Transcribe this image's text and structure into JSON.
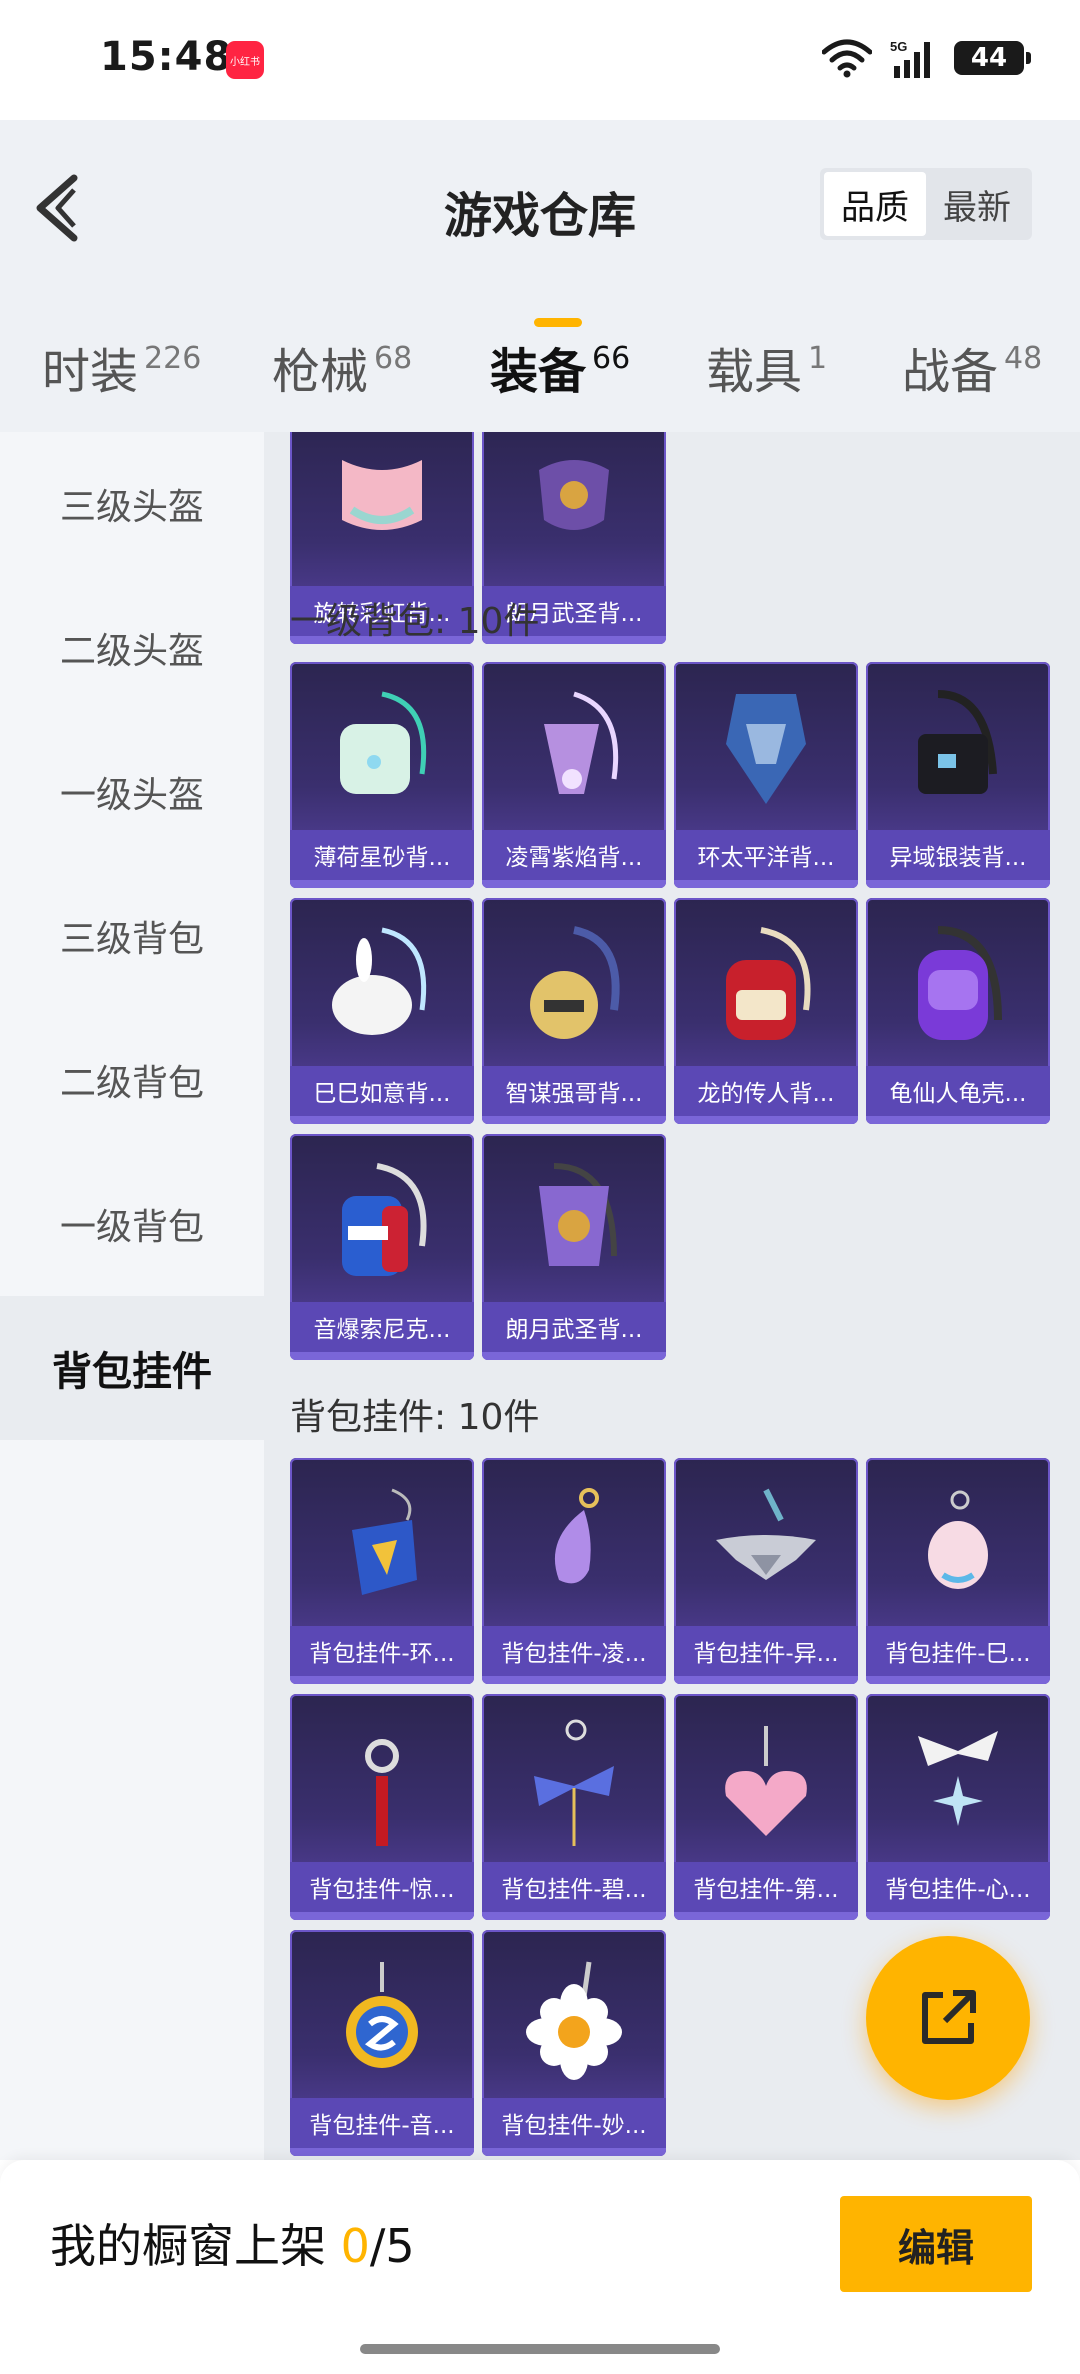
{
  "status_bar": {
    "time": "15:48",
    "app_badge": "小红书",
    "network": "5G",
    "battery": "44"
  },
  "header": {
    "title": "游戏仓库",
    "sort_options": [
      {
        "label": "品质",
        "active": true
      },
      {
        "label": "最新",
        "active": false
      }
    ]
  },
  "tabs": [
    {
      "label": "时装",
      "count": "226"
    },
    {
      "label": "枪械",
      "count": "68"
    },
    {
      "label": "装备",
      "count": "66",
      "active": true
    },
    {
      "label": "载具",
      "count": "1"
    },
    {
      "label": "战备",
      "count": "48"
    }
  ],
  "sidebar": {
    "items": [
      {
        "label": "三级头盔"
      },
      {
        "label": "二级头盔"
      },
      {
        "label": "一级头盔"
      },
      {
        "label": "三级背包"
      },
      {
        "label": "二级背包"
      },
      {
        "label": "一级背包"
      },
      {
        "label": "背包挂件",
        "active": true
      }
    ]
  },
  "sections": {
    "top_partial": [
      {
        "name": "旋转彩虹背...",
        "icon": "rainbow-backpack-icon"
      },
      {
        "name": "朗月武圣背...",
        "icon": "purple-backpack-icon"
      }
    ],
    "level1_backpack": {
      "title": "一级背包: 10件",
      "items": [
        {
          "name": "薄荷星砂背...",
          "icon": "mint-backpack-icon"
        },
        {
          "name": "凌霄紫焰背...",
          "icon": "lilac-backpack-icon"
        },
        {
          "name": "环太平洋背...",
          "icon": "mecha-backpack-icon"
        },
        {
          "name": "异域银装背...",
          "icon": "black-backpack-icon"
        },
        {
          "name": "巳巳如意背...",
          "icon": "white-bunny-backpack-icon"
        },
        {
          "name": "智谋强哥背...",
          "icon": "bear-backpack-icon"
        },
        {
          "name": "龙的传人背...",
          "icon": "red-backpack-icon"
        },
        {
          "name": "龟仙人龟壳...",
          "icon": "purple-shell-backpack-icon"
        },
        {
          "name": "音爆索尼克...",
          "icon": "sonic-backpack-icon"
        },
        {
          "name": "朗月武圣背...",
          "icon": "violet-backpack-icon"
        }
      ]
    },
    "charms": {
      "title": "背包挂件: 10件",
      "items": [
        {
          "name": "背包挂件-环...",
          "icon": "blue-mecha-charm-icon"
        },
        {
          "name": "背包挂件-凌...",
          "icon": "purple-drop-charm-icon"
        },
        {
          "name": "背包挂件-异...",
          "icon": "silver-wing-charm-icon"
        },
        {
          "name": "背包挂件-巳...",
          "icon": "pink-snake-charm-icon"
        },
        {
          "name": "背包挂件-惊...",
          "icon": "red-tassel-charm-icon"
        },
        {
          "name": "背包挂件-碧...",
          "icon": "blue-bow-charm-icon"
        },
        {
          "name": "背包挂件-第...",
          "icon": "pink-heart-charm-icon"
        },
        {
          "name": "背包挂件-心...",
          "icon": "white-bow-charm-icon"
        },
        {
          "name": "背包挂件-音...",
          "icon": "sonic-ring-charm-icon"
        },
        {
          "name": "背包挂件-妙...",
          "icon": "daisy-charm-icon"
        }
      ]
    }
  },
  "bottom_bar": {
    "shelf_label": "我的橱窗上架",
    "shelf_count": "0",
    "shelf_total": "/5",
    "edit_label": "编辑"
  },
  "colors": {
    "accent": "#ffb400",
    "card_top": "#2c2550",
    "card_label": "#5b48b5"
  }
}
